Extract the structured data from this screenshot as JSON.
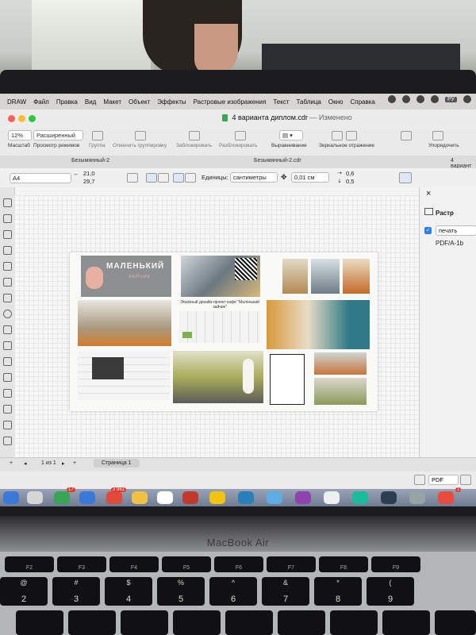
{
  "menubar": {
    "app": "DRAW",
    "items": [
      "Файл",
      "Правка",
      "Вид",
      "Макет",
      "Объект",
      "Эффекты",
      "Растровые изображения",
      "Текст",
      "Таблица",
      "Окно",
      "Справка"
    ],
    "lang": "РУ"
  },
  "window": {
    "doc_title": "4 варианта диплом.cdr",
    "doc_status": "— Изменено"
  },
  "toolbar": {
    "zoom": "12%",
    "zoom_label": "Масштаб",
    "view_mode": "Расширенный",
    "view_mode_label": "Просмотр режимов",
    "group": "Группа",
    "ungroup": "Отменить группировку",
    "lock": "Заблокировать",
    "unlock": "Разблокировать",
    "align": "Выравнивание",
    "mirror": "Зеркальное отражение",
    "order": "Упорядочить"
  },
  "tabs": {
    "tab1": "Безымянный-2",
    "tab2": "Безымянный-2.cdr",
    "tab3": "4 вариант"
  },
  "properties": {
    "page_size": "A4",
    "width": "21,0",
    "height": "29,7",
    "units_label": "Единицы:",
    "units_value": "сантиметры",
    "nudge": "0,01 см",
    "dup_x": "0,6",
    "dup_y": "0,5"
  },
  "sheet": {
    "logo_line1": "МАЛЕНЬКИЙ",
    "logo_line2": "ЗАЙЧИК",
    "caption": "Эскизный дизайн-проект кафе \"Маленький зайчик\""
  },
  "panel": {
    "title": "Растр",
    "print_label": "печать",
    "print_checked": true,
    "pdf_label": "PDF/A-1b"
  },
  "pagebar": {
    "page_of": "1 из 1",
    "page_tab": "Страница 1"
  },
  "statusbar": {
    "export": "PDF"
  },
  "dock": {
    "badges": [
      "17",
      "3 961",
      "1"
    ]
  },
  "device": {
    "brand": "MacBook Air"
  },
  "keyboard": {
    "fn_row": [
      {
        "top": "",
        "bot": "F2"
      },
      {
        "top": "",
        "bot": "F3"
      },
      {
        "top": "",
        "bot": "F4"
      },
      {
        "top": "",
        "bot": "F5"
      },
      {
        "top": "",
        "bot": "F6"
      },
      {
        "top": "",
        "bot": "F7"
      },
      {
        "top": "",
        "bot": "F8"
      },
      {
        "top": "",
        "bot": "F9"
      }
    ],
    "num_row": [
      {
        "top": "@",
        "bot": "2"
      },
      {
        "top": "#",
        "bot": "3"
      },
      {
        "top": "$",
        "bot": "4"
      },
      {
        "top": "%",
        "bot": "5"
      },
      {
        "top": "^",
        "bot": "6"
      },
      {
        "top": "&",
        "bot": "7"
      },
      {
        "top": "*",
        "bot": "8"
      },
      {
        "top": "(",
        "bot": "9"
      }
    ]
  },
  "colors": {
    "accent_blue": "#2d7ff9",
    "title_icon_green": "#3aa655",
    "badge_red": "#e03b30"
  }
}
